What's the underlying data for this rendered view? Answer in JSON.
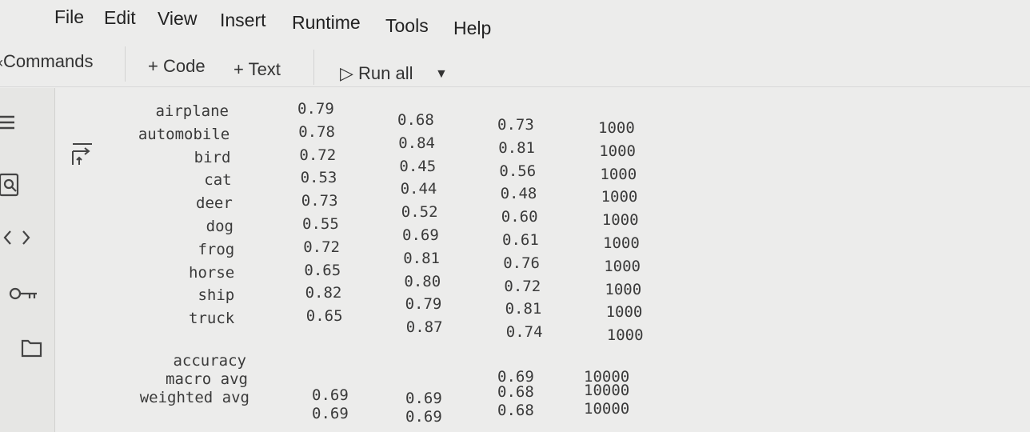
{
  "menu": [
    "File",
    "Edit",
    "View",
    "Insert",
    "Runtime",
    "Tools",
    "Help"
  ],
  "toolbar": {
    "commands_label": "Commands",
    "add_code_label": "+ Code",
    "add_text_label": "+ Text",
    "run_all_label": "▷ Run all"
  },
  "sidebar": {
    "icons": [
      "menu-icon",
      "search-icon",
      "code-icon",
      "key-icon",
      "folder-icon"
    ]
  },
  "report": {
    "rows": [
      {
        "label": "airplane",
        "precision": "0.79",
        "recall": "0.68",
        "f1": "0.73",
        "support": "1000"
      },
      {
        "label": "automobile",
        "precision": "0.78",
        "recall": "0.84",
        "f1": "0.81",
        "support": "1000"
      },
      {
        "label": "bird",
        "precision": "0.72",
        "recall": "0.45",
        "f1": "0.56",
        "support": "1000"
      },
      {
        "label": "cat",
        "precision": "0.53",
        "recall": "0.44",
        "f1": "0.48",
        "support": "1000"
      },
      {
        "label": "deer",
        "precision": "0.73",
        "recall": "0.52",
        "f1": "0.60",
        "support": "1000"
      },
      {
        "label": "dog",
        "precision": "0.55",
        "recall": "0.69",
        "f1": "0.61",
        "support": "1000"
      },
      {
        "label": "frog",
        "precision": "0.72",
        "recall": "0.81",
        "f1": "0.76",
        "support": "1000"
      },
      {
        "label": "horse",
        "precision": "0.65",
        "recall": "0.80",
        "f1": "0.72",
        "support": "1000"
      },
      {
        "label": "ship",
        "precision": "0.82",
        "recall": "0.79",
        "f1": "0.81",
        "support": "1000"
      },
      {
        "label": "truck",
        "precision": "0.65",
        "recall": "0.87",
        "f1": "0.74",
        "support": "1000"
      }
    ],
    "summary": [
      {
        "label": "accuracy",
        "precision": "",
        "recall": "",
        "f1": "0.69",
        "support": "10000"
      },
      {
        "label": "macro avg",
        "precision": "0.69",
        "recall": "0.69",
        "f1": "0.68",
        "support": "10000"
      },
      {
        "label": "weighted avg",
        "precision": "0.69",
        "recall": "0.69",
        "f1": "0.68",
        "support": "10000"
      }
    ]
  }
}
